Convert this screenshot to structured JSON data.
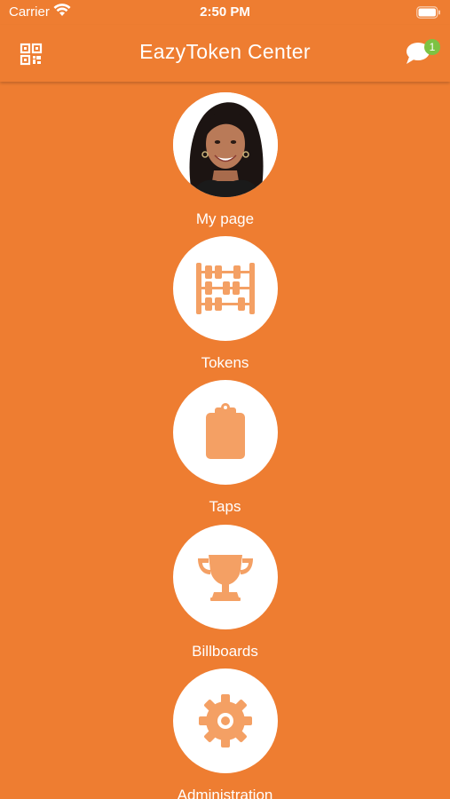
{
  "status_bar": {
    "carrier": "Carrier",
    "time": "2:50 PM",
    "wifi_icon": "wifi-icon",
    "battery_icon": "battery-icon"
  },
  "nav": {
    "title": "EazyToken Center",
    "left_icon": "qr-code-icon",
    "right_icon": "chat-icon",
    "badge_count": "1"
  },
  "menu": {
    "items": [
      {
        "label": "My page",
        "icon": "avatar-photo"
      },
      {
        "label": "Tokens",
        "icon": "abacus-icon"
      },
      {
        "label": "Taps",
        "icon": "clipboard-icon"
      },
      {
        "label": "Billboards",
        "icon": "trophy-icon"
      },
      {
        "label": "Administration",
        "icon": "gear-icon"
      }
    ]
  },
  "colors": {
    "background": "#ee7d31",
    "icon": "#f4a064",
    "badge": "#7dc243"
  }
}
